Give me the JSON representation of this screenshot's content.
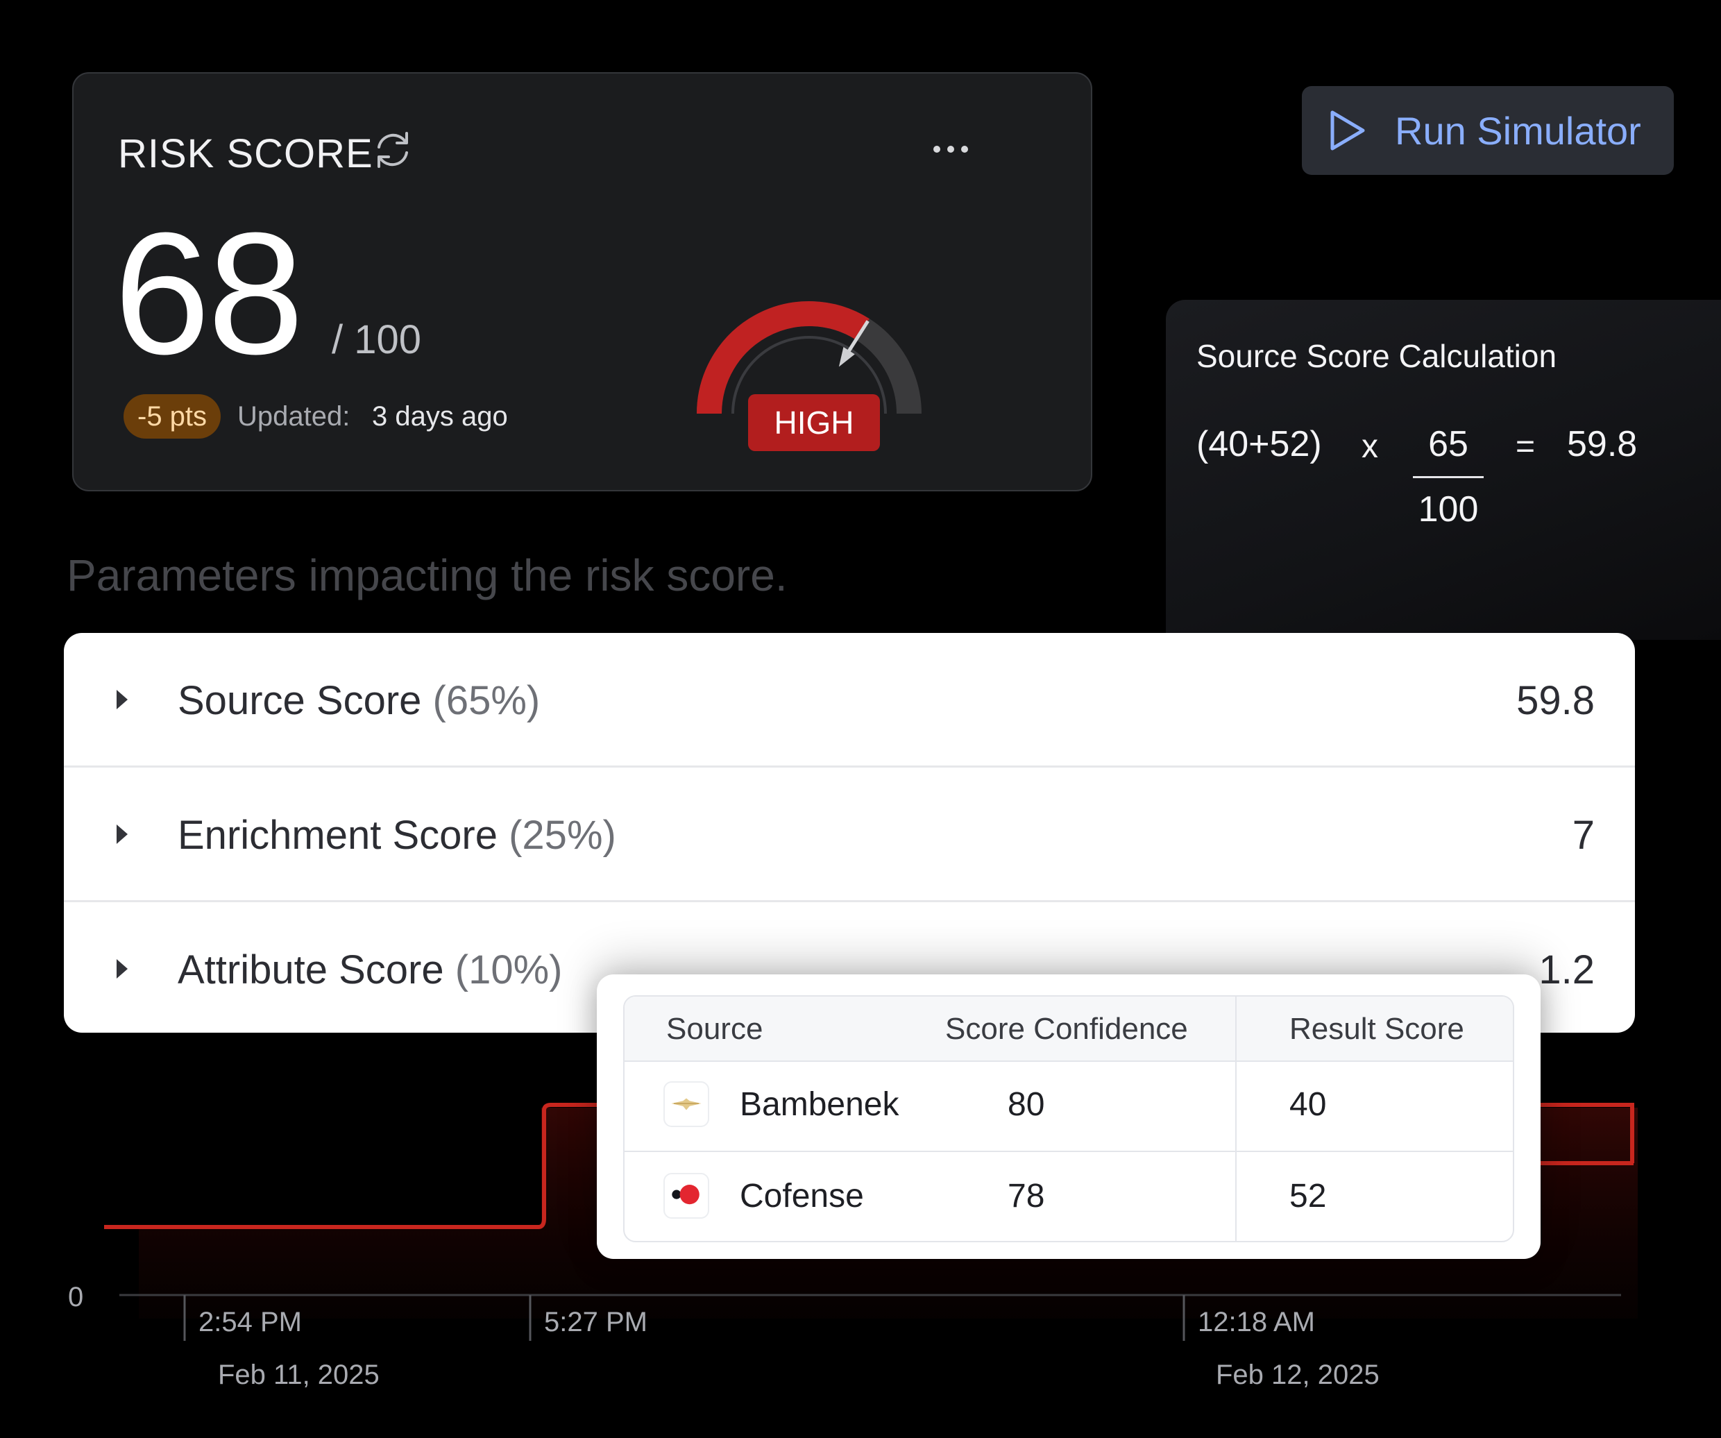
{
  "risk_card": {
    "title": "RISK SCORE",
    "score": "68",
    "max": "/ 100",
    "delta": "-5 pts",
    "updated_label": "Updated:",
    "updated_value": "3 days ago",
    "level": "HIGH",
    "gauge_fraction": 0.68,
    "colors": {
      "high": "#c02222",
      "track": "#3a3a3c"
    }
  },
  "simulator": {
    "label": "Run Simulator",
    "accent": "#8aaefc"
  },
  "calculation": {
    "title": "Source Score Calculation",
    "sum": "(40+52)",
    "times": "x",
    "numerator": "65",
    "denominator": "100",
    "equals": "=",
    "result": "59.8"
  },
  "parameters": {
    "heading": "Parameters impacting the risk score.",
    "rows": [
      {
        "name": "Source Score",
        "weight": "(65%)",
        "value": "59.8"
      },
      {
        "name": "Enrichment Score",
        "weight": "(25%)",
        "value": "7"
      },
      {
        "name": "Attribute Score",
        "weight": "(10%)",
        "value": "1.2"
      }
    ]
  },
  "sources_table": {
    "headers": [
      "Source",
      "Score Confidence",
      "Result Score"
    ],
    "rows": [
      {
        "source": "Bambenek",
        "confidence": "80",
        "result": "40",
        "icon": "bambenek-logo-icon"
      },
      {
        "source": "Cofense",
        "confidence": "78",
        "result": "52",
        "icon": "cofense-logo-icon"
      }
    ]
  },
  "chart": {
    "y_tick": "0",
    "ticks": [
      {
        "time": "2:54 PM",
        "date": "Feb 11, 2025"
      },
      {
        "time": "5:27 PM",
        "date": ""
      },
      {
        "time": "12:18 AM",
        "date": "Feb 12, 2025"
      }
    ],
    "line_color": "#c8261e"
  }
}
